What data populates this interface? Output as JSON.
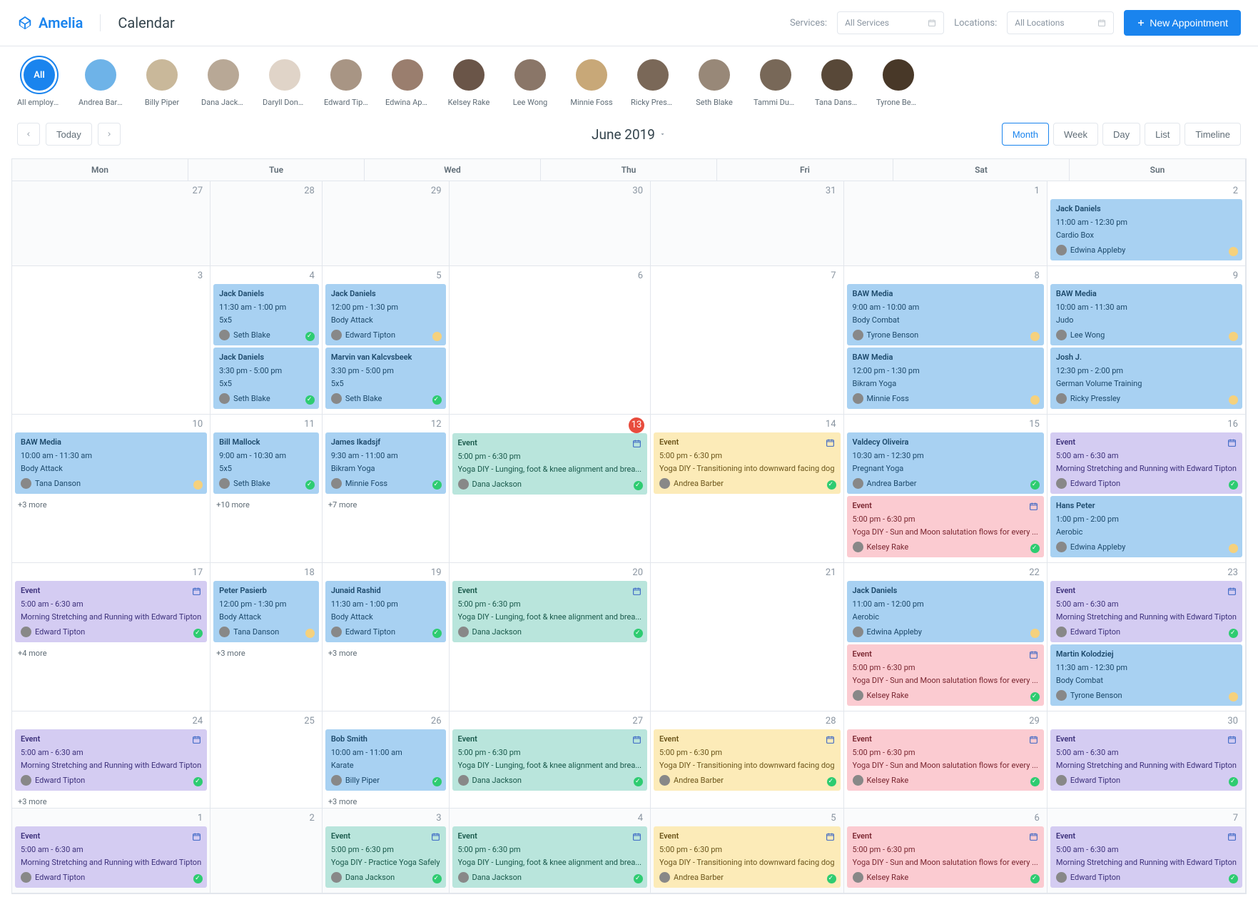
{
  "brand": "Amelia",
  "pageTitle": "Calendar",
  "filters": {
    "servicesLabel": "Services:",
    "servicesPlaceholder": "All Services",
    "locationsLabel": "Locations:",
    "locationsPlaceholder": "All Locations"
  },
  "newAppointment": "New Appointment",
  "employees": [
    {
      "name": "All employees",
      "label": "All",
      "active": true
    },
    {
      "name": "Andrea Barber",
      "bg": "#6EB3E8"
    },
    {
      "name": "Billy Piper",
      "bg": "#c9b89a"
    },
    {
      "name": "Dana Jackson",
      "bg": "#b8a896"
    },
    {
      "name": "Daryll Donov...",
      "bg": "#e0d4c8"
    },
    {
      "name": "Edward Tipton",
      "bg": "#a89584"
    },
    {
      "name": "Edwina Appl...",
      "bg": "#9a7e6e"
    },
    {
      "name": "Kelsey Rake",
      "bg": "#6a5548"
    },
    {
      "name": "Lee Wong",
      "bg": "#8a7668"
    },
    {
      "name": "Minnie Foss",
      "bg": "#c8a878"
    },
    {
      "name": "Ricky Pressley",
      "bg": "#7a6858"
    },
    {
      "name": "Seth Blake",
      "bg": "#988878"
    },
    {
      "name": "Tammi Dukes",
      "bg": "#786858"
    },
    {
      "name": "Tana Danson",
      "bg": "#584838"
    },
    {
      "name": "Tyrone Benson",
      "bg": "#483828"
    }
  ],
  "toolbar": {
    "today": "Today",
    "dateTitle": "June 2019",
    "views": [
      "Month",
      "Week",
      "Day",
      "List",
      "Timeline"
    ],
    "activeView": "Month"
  },
  "weekdays": [
    "Mon",
    "Tue",
    "Wed",
    "Thu",
    "Fri",
    "Sat",
    "Sun"
  ],
  "cells": [
    {
      "day": "27",
      "dim": true
    },
    {
      "day": "28",
      "dim": true
    },
    {
      "day": "29",
      "dim": true
    },
    {
      "day": "30",
      "dim": true
    },
    {
      "day": "31",
      "dim": true
    },
    {
      "day": "1",
      "dim": true
    },
    {
      "day": "2",
      "events": [
        {
          "color": "blue",
          "title": "Jack Daniels",
          "time": "11:00 am - 12:30 pm",
          "service": "Cardio Box",
          "person": "Edwina Appleby",
          "status": "pending"
        }
      ]
    },
    {
      "day": "3"
    },
    {
      "day": "4",
      "events": [
        {
          "color": "blue",
          "title": "Jack Daniels",
          "time": "11:30 am - 1:00 pm",
          "service": "5x5",
          "person": "Seth Blake",
          "status": "ok"
        },
        {
          "color": "blue",
          "title": "Jack Daniels",
          "time": "3:30 pm - 5:00 pm",
          "service": "5x5",
          "person": "Seth Blake",
          "status": "ok"
        }
      ]
    },
    {
      "day": "5",
      "events": [
        {
          "color": "blue",
          "title": "Jack Daniels",
          "time": "12:00 pm - 1:30 pm",
          "service": "Body Attack",
          "person": "Edward Tipton",
          "status": "pending"
        },
        {
          "color": "blue",
          "title": "Marvin van Kalcvsbeek",
          "time": "3:30 pm - 5:00 pm",
          "service": "5x5",
          "person": "Seth Blake",
          "status": "ok"
        }
      ]
    },
    {
      "day": "6"
    },
    {
      "day": "7"
    },
    {
      "day": "8",
      "events": [
        {
          "color": "blue",
          "title": "BAW Media",
          "time": "9:00 am - 10:00 am",
          "service": "Body Combat",
          "person": "Tyrone Benson",
          "status": "pending"
        },
        {
          "color": "blue",
          "title": "BAW Media",
          "time": "12:00 pm - 1:30 pm",
          "service": "Bikram Yoga",
          "person": "Minnie Foss",
          "status": "pending"
        }
      ]
    },
    {
      "day": "9",
      "events": [
        {
          "color": "blue",
          "title": "BAW Media",
          "time": "10:00 am - 11:30 am",
          "service": "Judo",
          "person": "Lee Wong",
          "status": "pending"
        },
        {
          "color": "blue",
          "title": "Josh J.",
          "time": "12:30 pm - 2:00 pm",
          "service": "German Volume Training",
          "person": "Ricky Pressley",
          "status": "pending"
        }
      ]
    },
    {
      "day": "10",
      "events": [
        {
          "color": "blue",
          "title": "BAW Media",
          "time": "10:00 am - 11:30 am",
          "service": "Body Attack",
          "person": "Tana Danson",
          "status": "pending"
        }
      ],
      "more": "+3 more"
    },
    {
      "day": "11",
      "events": [
        {
          "color": "blue",
          "title": "Bill Mallock",
          "time": "9:00 am - 10:30 am",
          "service": "5x5",
          "person": "Seth Blake",
          "status": "ok"
        }
      ],
      "more": "+10 more"
    },
    {
      "day": "12",
      "events": [
        {
          "color": "blue",
          "title": "James Ikadsjf",
          "time": "9:30 am - 11:00 am",
          "service": "Bikram Yoga",
          "person": "Minnie Foss",
          "status": "ok"
        }
      ],
      "more": "+7 more"
    },
    {
      "day": "13",
      "today": true,
      "events": [
        {
          "color": "teal",
          "title": "Event",
          "icon": true,
          "time": "5:00 pm - 6:30 pm",
          "service": "Yoga DIY - Lunging, foot & knee alignment and brea...",
          "person": "Dana Jackson",
          "status": "ok"
        }
      ]
    },
    {
      "day": "14",
      "events": [
        {
          "color": "yellow",
          "title": "Event",
          "icon": true,
          "time": "5:00 pm - 6:30 pm",
          "service": "Yoga DIY - Transitioning into downward facing dog",
          "person": "Andrea Barber",
          "status": "ok"
        }
      ]
    },
    {
      "day": "15",
      "events": [
        {
          "color": "blue",
          "title": "Valdecy Oliveira",
          "time": "10:30 am - 12:30 pm",
          "service": "Pregnant Yoga",
          "person": "Andrea Barber",
          "status": "ok"
        },
        {
          "color": "pink",
          "title": "Event",
          "icon": true,
          "time": "5:00 pm - 6:30 pm",
          "service": "Yoga DIY - Sun and Moon salutation flows for every ...",
          "person": "Kelsey Rake",
          "status": "ok"
        }
      ]
    },
    {
      "day": "16",
      "events": [
        {
          "color": "purple",
          "title": "Event",
          "icon": true,
          "time": "5:00 am - 6:30 am",
          "service": "Morning Stretching and Running with Edward Tipton",
          "person": "Edward Tipton",
          "status": "ok"
        },
        {
          "color": "blue",
          "title": "Hans Peter",
          "time": "1:00 pm - 2:00 pm",
          "service": "Aerobic",
          "person": "Edwina Appleby",
          "status": "pending"
        }
      ]
    },
    {
      "day": "17",
      "events": [
        {
          "color": "purple",
          "title": "Event",
          "icon": true,
          "time": "5:00 am - 6:30 am",
          "service": "Morning Stretching and Running with Edward Tipton",
          "person": "Edward Tipton",
          "status": "ok"
        }
      ],
      "more": "+4 more"
    },
    {
      "day": "18",
      "events": [
        {
          "color": "blue",
          "title": "Peter Pasierb",
          "time": "12:00 pm - 1:30 pm",
          "service": "Body Attack",
          "person": "Tana Danson",
          "status": "pending"
        }
      ],
      "more": "+3 more"
    },
    {
      "day": "19",
      "events": [
        {
          "color": "blue",
          "title": "Junaid Rashid",
          "time": "11:30 am - 1:00 pm",
          "service": "Body Attack",
          "person": "Edward Tipton",
          "status": "ok"
        }
      ],
      "more": "+3 more"
    },
    {
      "day": "20",
      "events": [
        {
          "color": "teal",
          "title": "Event",
          "icon": true,
          "time": "5:00 pm - 6:30 pm",
          "service": "Yoga DIY - Lunging, foot & knee alignment and brea...",
          "person": "Dana Jackson",
          "status": "ok"
        }
      ]
    },
    {
      "day": "21"
    },
    {
      "day": "22",
      "events": [
        {
          "color": "blue",
          "title": "Jack Daniels",
          "time": "11:00 am - 12:00 pm",
          "service": "Aerobic",
          "person": "Edwina Appleby",
          "status": "pending"
        },
        {
          "color": "pink",
          "title": "Event",
          "icon": true,
          "time": "5:00 pm - 6:30 pm",
          "service": "Yoga DIY - Sun and Moon salutation flows for every ...",
          "person": "Kelsey Rake",
          "status": "ok"
        }
      ]
    },
    {
      "day": "23",
      "events": [
        {
          "color": "purple",
          "title": "Event",
          "icon": true,
          "time": "5:00 am - 6:30 am",
          "service": "Morning Stretching and Running with Edward Tipton",
          "person": "Edward Tipton",
          "status": "ok"
        },
        {
          "color": "blue",
          "title": "Martin Kolodziej",
          "time": "11:30 am - 12:30 pm",
          "service": "Body Combat",
          "person": "Tyrone Benson",
          "status": "pending"
        }
      ]
    },
    {
      "day": "24",
      "events": [
        {
          "color": "purple",
          "title": "Event",
          "icon": true,
          "time": "5:00 am - 6:30 am",
          "service": "Morning Stretching and Running with Edward Tipton",
          "person": "Edward Tipton",
          "status": "ok"
        }
      ],
      "more": "+3 more"
    },
    {
      "day": "25"
    },
    {
      "day": "26",
      "events": [
        {
          "color": "blue",
          "title": "Bob Smith",
          "time": "10:00 am - 11:00 am",
          "service": "Karate",
          "person": "Billy Piper",
          "status": "ok"
        }
      ],
      "more": "+3 more"
    },
    {
      "day": "27",
      "events": [
        {
          "color": "teal",
          "title": "Event",
          "icon": true,
          "time": "5:00 pm - 6:30 pm",
          "service": "Yoga DIY - Lunging, foot & knee alignment and brea...",
          "person": "Dana Jackson",
          "status": "ok"
        }
      ]
    },
    {
      "day": "28",
      "events": [
        {
          "color": "yellow",
          "title": "Event",
          "icon": true,
          "time": "5:00 pm - 6:30 pm",
          "service": "Yoga DIY - Transitioning into downward facing dog",
          "person": "Andrea Barber",
          "status": "ok"
        }
      ]
    },
    {
      "day": "29",
      "events": [
        {
          "color": "pink",
          "title": "Event",
          "icon": true,
          "time": "5:00 pm - 6:30 pm",
          "service": "Yoga DIY - Sun and Moon salutation flows for every ...",
          "person": "Kelsey Rake",
          "status": "ok"
        }
      ]
    },
    {
      "day": "30",
      "events": [
        {
          "color": "purple",
          "title": "Event",
          "icon": true,
          "time": "5:00 am - 6:30 am",
          "service": "Morning Stretching and Running with Edward Tipton",
          "person": "Edward Tipton",
          "status": "ok"
        }
      ]
    },
    {
      "day": "1",
      "dim": true,
      "events": [
        {
          "color": "purple",
          "title": "Event",
          "icon": true,
          "time": "5:00 am - 6:30 am",
          "service": "Morning Stretching and Running with Edward Tipton",
          "person": "Edward Tipton",
          "status": "ok"
        }
      ]
    },
    {
      "day": "2",
      "dim": true
    },
    {
      "day": "3",
      "dim": true,
      "events": [
        {
          "color": "teal",
          "title": "Event",
          "icon": true,
          "time": "5:00 pm - 6:30 pm",
          "service": "Yoga DIY - Practice Yoga Safely",
          "person": "Dana Jackson",
          "status": "ok"
        }
      ]
    },
    {
      "day": "4",
      "dim": true,
      "events": [
        {
          "color": "teal",
          "title": "Event",
          "icon": true,
          "time": "5:00 pm - 6:30 pm",
          "service": "Yoga DIY - Lunging, foot & knee alignment and brea...",
          "person": "Dana Jackson",
          "status": "ok"
        }
      ]
    },
    {
      "day": "5",
      "dim": true,
      "events": [
        {
          "color": "yellow",
          "title": "Event",
          "icon": true,
          "time": "5:00 pm - 6:30 pm",
          "service": "Yoga DIY - Transitioning into downward facing dog",
          "person": "Andrea Barber",
          "status": "ok"
        }
      ]
    },
    {
      "day": "6",
      "dim": true,
      "events": [
        {
          "color": "pink",
          "title": "Event",
          "icon": true,
          "time": "5:00 pm - 6:30 pm",
          "service": "Yoga DIY - Sun and Moon salutation flows for every ...",
          "person": "Kelsey Rake",
          "status": "ok"
        }
      ]
    },
    {
      "day": "7",
      "dim": true,
      "events": [
        {
          "color": "purple",
          "title": "Event",
          "icon": true,
          "time": "5:00 am - 6:30 am",
          "service": "Morning Stretching and Running with Edward Tipton",
          "person": "Edward Tipton",
          "status": "ok"
        }
      ]
    }
  ]
}
